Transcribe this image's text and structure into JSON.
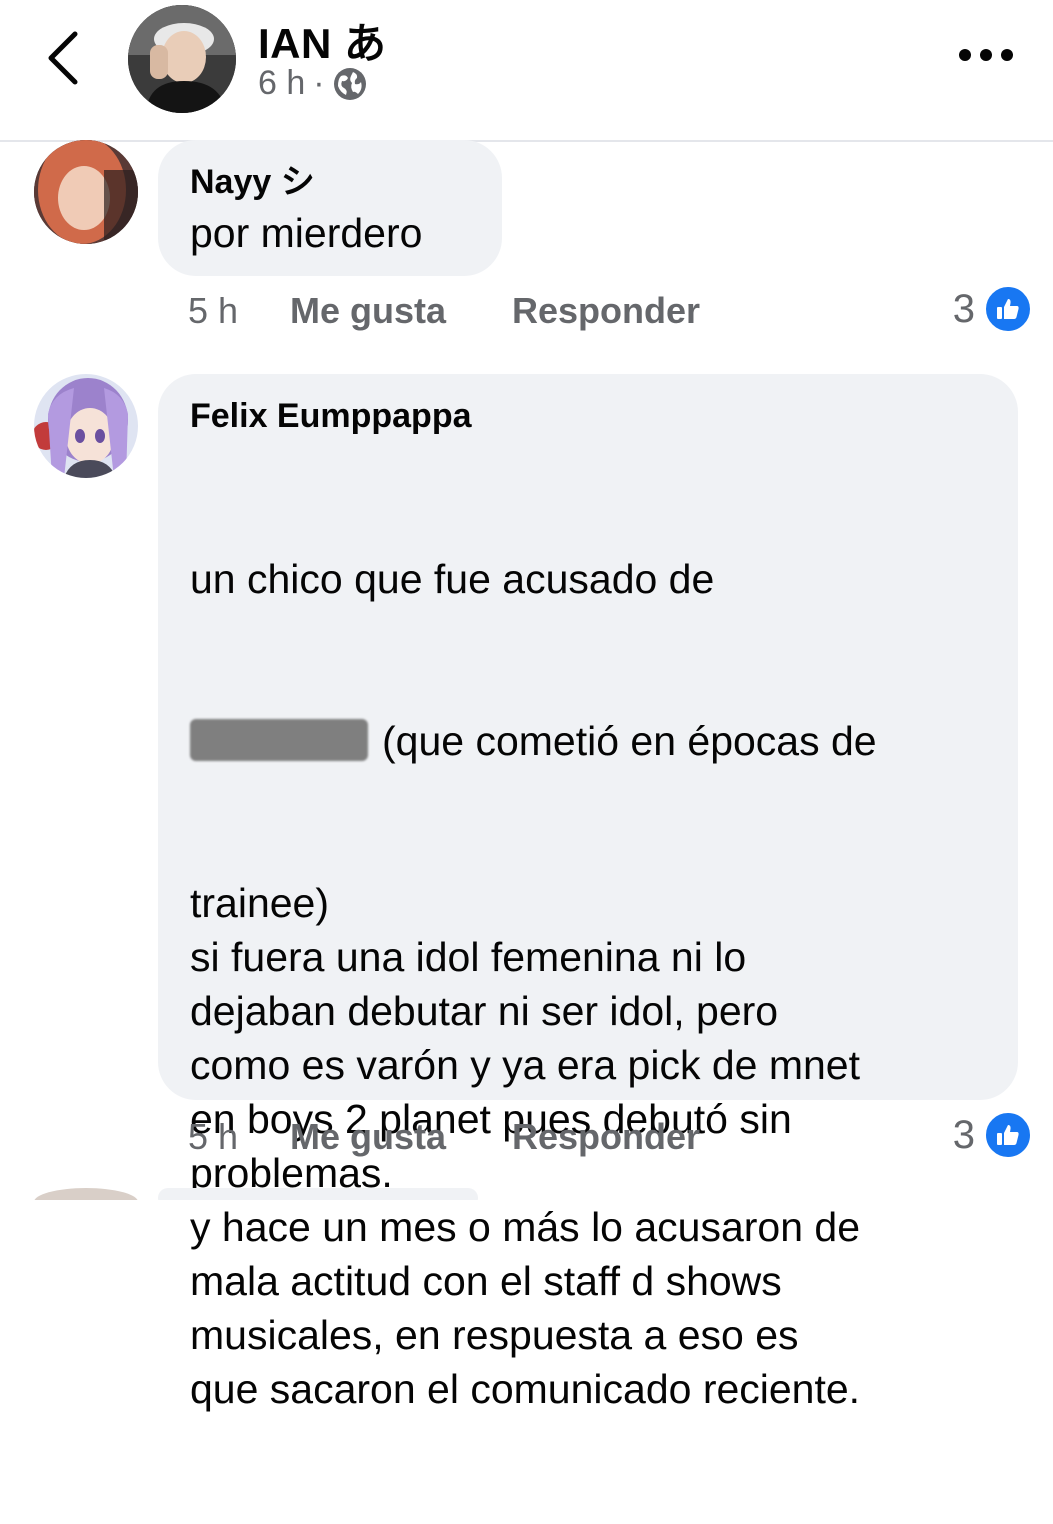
{
  "header": {
    "back_icon": "chevron-left-icon",
    "name": "IAN あ",
    "time": "6 h",
    "separator": "·",
    "privacy_icon": "globe-icon",
    "more_icon": "more-horizontal-icon"
  },
  "comments": [
    {
      "author": "Nayy シ",
      "text": "por mierdero",
      "time": "5 h",
      "like_label": "Me gusta",
      "reply_label": "Responder",
      "reaction_count": "3",
      "reaction_icon": "like-icon"
    },
    {
      "author": "Felix Eumppappa",
      "text_line1": "un chico que fue acusado de",
      "text_redacted_suffix": "(que cometió en épocas de",
      "text_rest": "trainee)\nsi fuera una idol femenina ni lo\ndejaban debutar ni ser idol, pero\ncomo es varón y ya era pick de mnet\nen boys 2 planet pues debutó sin\nproblemas.\ny hace un mes o más lo acusaron de\nmala actitud con el staff d shows\nmusicales, en respuesta a eso es\nque sacaron el comunicado reciente.",
      "time": "5 h",
      "like_label": "Me gusta",
      "reply_label": "Responder",
      "reaction_count": "3",
      "reaction_icon": "like-icon"
    }
  ],
  "colors": {
    "bubble": "#f0f2f5",
    "secondary_text": "#65676b",
    "like_blue": "#1877f2",
    "primary_text": "#050505"
  }
}
